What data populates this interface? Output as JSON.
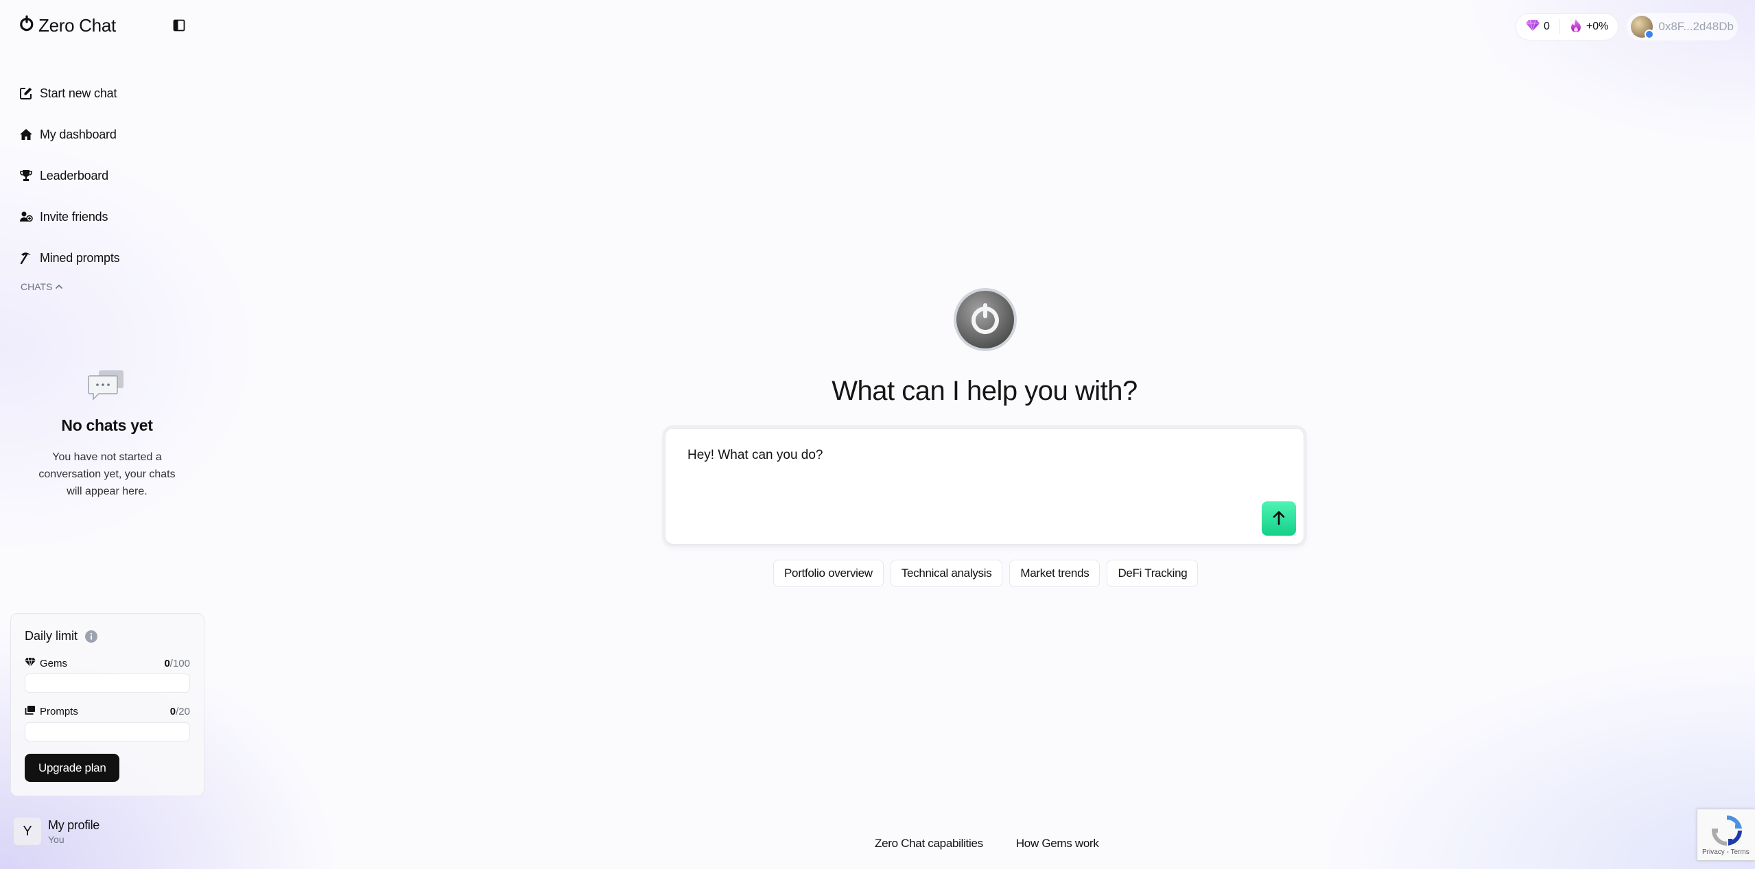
{
  "brand": {
    "name": "Zero Chat",
    "icon": "zero-logo-icon"
  },
  "sidebar": {
    "nav": [
      {
        "label": "Start new chat",
        "icon": "edit-icon"
      },
      {
        "label": "My dashboard",
        "icon": "home-icon"
      },
      {
        "label": "Leaderboard",
        "icon": "trophy-icon"
      },
      {
        "label": "Invite friends",
        "icon": "add-user-icon"
      },
      {
        "label": "Mined prompts",
        "icon": "pickaxe-icon"
      }
    ],
    "chats_label": "CHATS",
    "empty": {
      "title": "No chats yet",
      "description": "You have not started a conversation yet, your chats will appear here."
    }
  },
  "daily_limit": {
    "title": "Daily limit",
    "gems": {
      "label": "Gems",
      "used": "0",
      "max": "/100",
      "fraction": 0
    },
    "prompts": {
      "label": "Prompts",
      "used": "0",
      "max": "/20",
      "fraction": 0
    },
    "upgrade_label": "Upgrade plan"
  },
  "profile": {
    "initial": "Y",
    "name": "My profile",
    "sub": "You"
  },
  "topbar": {
    "gems_count": "0",
    "boost": "+0%",
    "wallet": "0x8F...2d48Db"
  },
  "main": {
    "headline": "What can I help you with?",
    "composer_value": "Hey! What can you do?",
    "chips": [
      "Portfolio overview",
      "Technical analysis",
      "Market trends",
      "DeFi Tracking"
    ]
  },
  "footer": {
    "capabilities": "Zero Chat capabilities",
    "gems": "How Gems work"
  },
  "recaptcha": {
    "links": "Privacy - Terms"
  },
  "colors": {
    "accent": "#1fd98f",
    "gem": "#a21caf",
    "flame": "#c026d3"
  }
}
